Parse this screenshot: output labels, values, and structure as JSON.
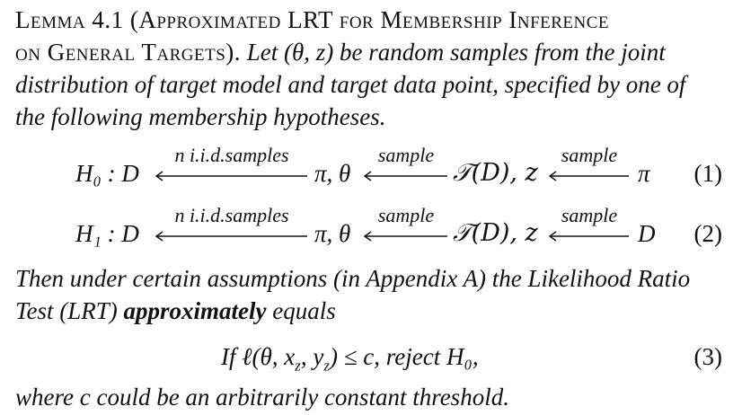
{
  "lemma": {
    "heading": "Lemma 4.1 (Approximated LRT for Membership Inference",
    "heading_cont": "on General Targets).",
    "statement_1": "Let (θ, z) be random samples from the joint",
    "statement_2": "distribution of target model and target data point, specified by one of",
    "statement_3": "the following membership hypotheses."
  },
  "hypotheses": [
    {
      "lhs": "H₀ : D",
      "label_1": "n i.i.d.samples",
      "mid_1": "π, θ",
      "label_2": "sample",
      "mid_2": "𝒯(D), z",
      "label_3": "sample",
      "rhs": "π",
      "number": "(1)"
    },
    {
      "lhs": "H₁ : D",
      "label_1": "n i.i.d.samples",
      "mid_1": "π, θ",
      "label_2": "sample",
      "mid_2": "𝒯(D), z",
      "label_3": "sample",
      "rhs": "D",
      "number": "(2)"
    }
  ],
  "conclusion": {
    "line_1": "Then under certain assumptions (in Appendix A) the Likelihood Ratio",
    "line_2_pre": "Test (LRT) ",
    "line_2_bold": "approximately",
    "line_2_post": " equals"
  },
  "test_equation": {
    "text": "If ℓ(θ, x",
    "sub_z1": "z",
    "mid": ", y",
    "sub_z2": "z",
    "tail": ") ≤ c,  reject H₀,",
    "number": "(3)"
  },
  "closing": "where c could be an arbitrarily constant threshold."
}
